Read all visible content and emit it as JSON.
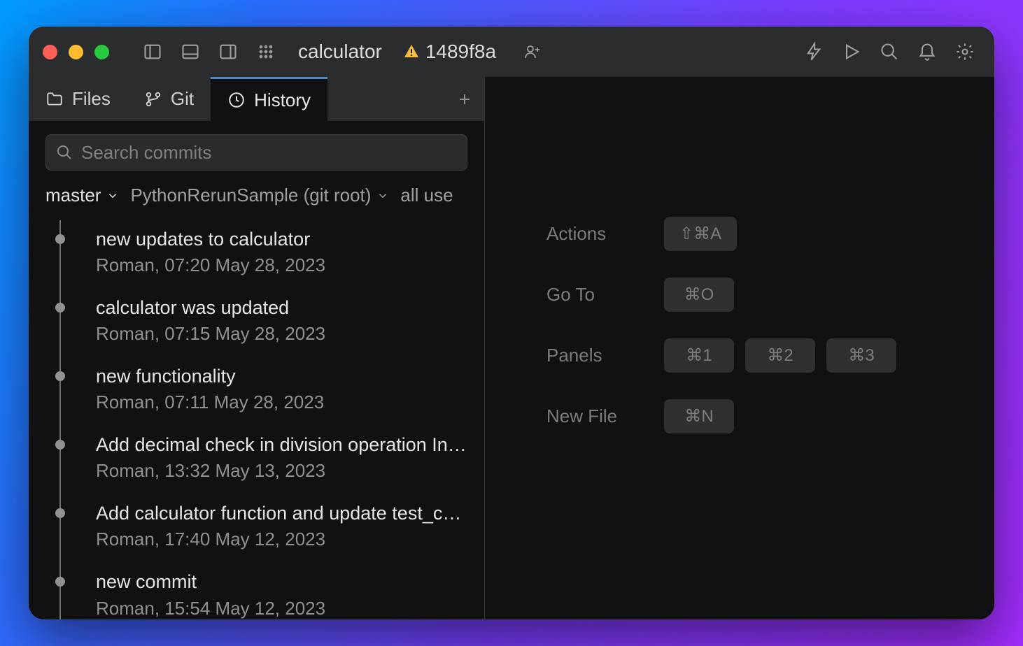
{
  "titlebar": {
    "project_name": "calculator",
    "commit_hash": "1489f8a"
  },
  "tabs": [
    {
      "label": "Files",
      "icon": "folder-icon",
      "active": false
    },
    {
      "label": "Git",
      "icon": "branch-icon",
      "active": false
    },
    {
      "label": "History",
      "icon": "clock-icon",
      "active": true
    }
  ],
  "search": {
    "placeholder": "Search commits"
  },
  "filters": {
    "branch": "master",
    "root": "PythonRerunSample (git root)",
    "user": "all use"
  },
  "commits": [
    {
      "title": "new updates to calculator",
      "meta": "Roman, 07:20 May 28, 2023"
    },
    {
      "title": "calculator was updated",
      "meta": "Roman, 07:15 May 28, 2023"
    },
    {
      "title": "new functionality",
      "meta": "Roman, 07:11 May 28, 2023"
    },
    {
      "title": "Add decimal check in division operation  In th…",
      "meta": "Roman, 13:32 May 13, 2023"
    },
    {
      "title": "Add calculator function and update test_car  …",
      "meta": "Roman, 17:40 May 12, 2023"
    },
    {
      "title": "new commit",
      "meta": "Roman, 15:54 May 12, 2023"
    }
  ],
  "shortcuts": {
    "actions": {
      "label": "Actions",
      "keys": [
        "⇧⌘A"
      ]
    },
    "goto": {
      "label": "Go To",
      "keys": [
        "⌘O"
      ]
    },
    "panels": {
      "label": "Panels",
      "keys": [
        "⌘1",
        "⌘2",
        "⌘3"
      ]
    },
    "newfile": {
      "label": "New File",
      "keys": [
        "⌘N"
      ]
    }
  }
}
